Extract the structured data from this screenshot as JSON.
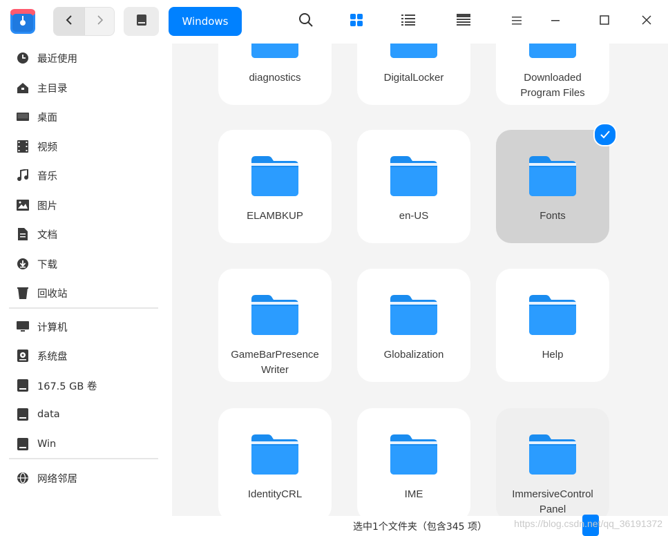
{
  "toolbar": {
    "breadcrumb_label": "Windows",
    "accent_color": "#0081ff"
  },
  "icons": {
    "app_logo": "file-manager-app-icon",
    "back": "chevron-left-icon",
    "forward": "chevron-right-icon",
    "drive": "drive-icon",
    "search": "search-icon",
    "icon_view": "grid-view-icon",
    "list_view": "list-view-icon",
    "detail_view": "detail-view-icon",
    "menu": "hamburger-menu-icon",
    "minimize": "minimize-icon",
    "maximize": "maximize-icon",
    "close": "close-icon"
  },
  "sidebar": {
    "items": [
      {
        "label": "最近使用",
        "icon": "clock-icon"
      },
      {
        "label": "主目录",
        "icon": "home-icon"
      },
      {
        "label": "桌面",
        "icon": "desktop-icon"
      },
      {
        "label": "视频",
        "icon": "video-icon"
      },
      {
        "label": "音乐",
        "icon": "music-icon"
      },
      {
        "label": "图片",
        "icon": "picture-icon"
      },
      {
        "label": "文档",
        "icon": "document-icon"
      },
      {
        "label": "下载",
        "icon": "download-icon"
      },
      {
        "label": "回收站",
        "icon": "trash-icon"
      }
    ],
    "devices": [
      {
        "label": "计算机",
        "icon": "computer-icon"
      },
      {
        "label": "系统盘",
        "icon": "system-disk-icon"
      },
      {
        "label": "167.5 GB 卷",
        "icon": "disk-icon"
      },
      {
        "label": "data",
        "icon": "disk-icon"
      },
      {
        "label": "Win",
        "icon": "disk-icon"
      }
    ],
    "network": [
      {
        "label": "网络邻居",
        "icon": "network-icon"
      }
    ]
  },
  "files": {
    "rows": [
      [
        "diagnostics",
        "DigitalLocker",
        "Downloaded\nProgram Files"
      ],
      [
        "ELAMBKUP",
        "en-US",
        "Fonts"
      ],
      [
        "GameBarPresence\nWriter",
        "Globalization",
        "Help"
      ],
      [
        "IdentityCRL",
        "IME",
        "ImmersiveControl\nPanel"
      ]
    ],
    "selected": "Fonts",
    "hovered": "ImmersiveControl\nPanel"
  },
  "status": {
    "text": "选中1个文件夹（包含345 项）"
  },
  "watermark": "https://blog.csdn.net/qq_36191372"
}
